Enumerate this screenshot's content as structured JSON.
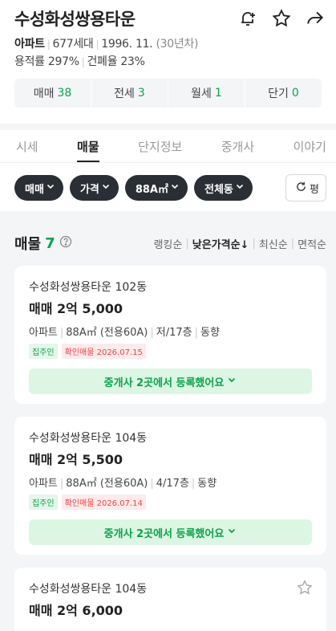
{
  "header": {
    "title": "수성화성쌍용타운",
    "icons": [
      "alarm-plus-icon",
      "star-icon",
      "share-icon"
    ],
    "type": "아파트",
    "households": "677세대",
    "built": "1996. 11.",
    "age": "(30년차)",
    "floor_area_ratio": "용적률 297%",
    "building_coverage": "건폐율 23%"
  },
  "counts": [
    {
      "label": "매매",
      "value": "38"
    },
    {
      "label": "전세",
      "value": "3"
    },
    {
      "label": "월세",
      "value": "1"
    },
    {
      "label": "단기",
      "value": "0"
    }
  ],
  "tabs": [
    {
      "label": "시세",
      "active": false
    },
    {
      "label": "매물",
      "active": true
    },
    {
      "label": "단지정보",
      "active": false
    },
    {
      "label": "중개사",
      "active": false
    },
    {
      "label": "이야기",
      "active": false
    }
  ],
  "filters": [
    "매매",
    "가격",
    "88A㎡",
    "전체동"
  ],
  "refresh_label": "평",
  "list": {
    "title": "매물",
    "count": "7",
    "sorts": [
      {
        "label": "랭킹순",
        "active": false
      },
      {
        "label": "낮은가격순↓",
        "active": true
      },
      {
        "label": "최신순",
        "active": false
      },
      {
        "label": "면적순",
        "active": false
      }
    ]
  },
  "listings": [
    {
      "complex": "수성화성쌍용타운 102동",
      "price": "매매 2억 5,000",
      "type": "아파트",
      "area": "88A㎡ (전용60A)",
      "floor": "저/17층",
      "direction": "동향",
      "badge1": "집주인",
      "badge2": "확인매물 2026.07.15",
      "agent_label": "중개사 2곳에서 등록했어요"
    },
    {
      "complex": "수성화성쌍용타운 104동",
      "price": "매매 2억 5,500",
      "type": "아파트",
      "area": "88A㎡ (전용60A)",
      "floor": "4/17층",
      "direction": "동향",
      "badge1": "집주인",
      "badge2": "확인매물 2026.07.14",
      "agent_label": "중개사 2곳에서 등록했어요"
    },
    {
      "complex": "수성화성쌍용타운 104동",
      "price": "매매 2억 6,000"
    }
  ],
  "colors": {
    "accent": "#0aa34a",
    "chip": "#2a2f36",
    "badge_red": "#e44444"
  }
}
